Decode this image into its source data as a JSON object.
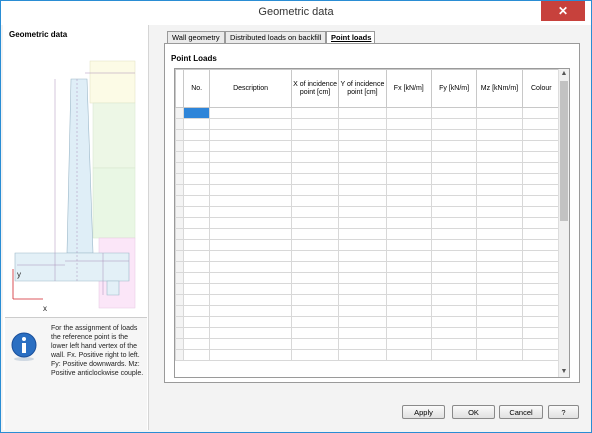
{
  "window": {
    "title": "Geometric data",
    "close_icon": "close-icon"
  },
  "left": {
    "title": "Geometric data",
    "axis_x": "x",
    "axis_y": "y",
    "info_text": "For the assignment of loads the reference point is the lower left hand vertex of the wall. Fx. Positive right to left. Fy: Positive downwards. Mz: Positive anticlockwise couple."
  },
  "tabs": [
    {
      "label": "Wall geometry",
      "active": false
    },
    {
      "label": "Distributed loads on backfill",
      "active": false
    },
    {
      "label": "Point loads",
      "active": true
    }
  ],
  "section_title": "Point Loads",
  "columns": [
    "No.",
    "Description",
    "X of incidence point [cm]",
    "Y of incidence point [cm]",
    "Fx [kN/m]",
    "Fy [kN/m]",
    "Mz [kNm/m]",
    "Colour"
  ],
  "buttons": {
    "apply": "Apply",
    "ok": "OK",
    "cancel": "Cancel",
    "help": "?"
  },
  "colors": {
    "selected_cell": "#2e85d9",
    "accent": "#2a8dd4",
    "close": "#c7413c"
  }
}
